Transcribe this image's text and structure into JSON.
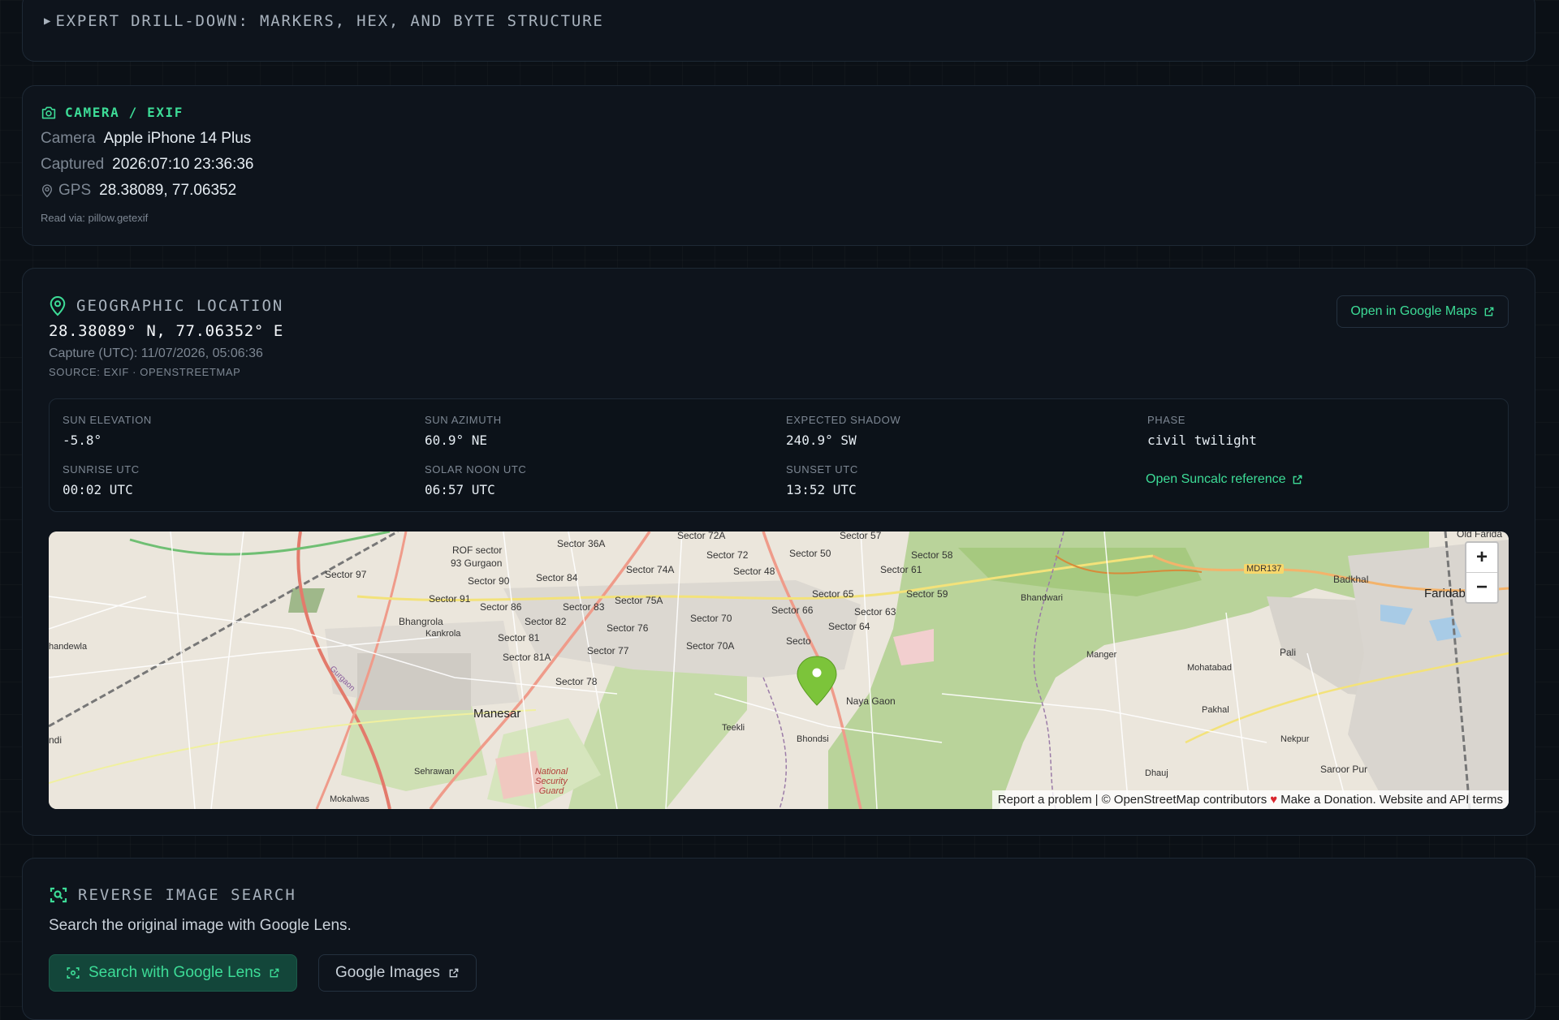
{
  "drilldown": {
    "title": "EXPERT DRILL-DOWN: MARKERS, HEX, AND BYTE STRUCTURE"
  },
  "exif": {
    "title": "CAMERA / EXIF",
    "camera_label": "Camera",
    "camera_value": "Apple iPhone 14 Plus",
    "captured_label": "Captured",
    "captured_value": "2026:07:10 23:36:36",
    "gps_label": "GPS",
    "gps_value": "28.38089, 77.06352",
    "read_via": "Read via: pillow.getexif"
  },
  "geo": {
    "title": "GEOGRAPHIC LOCATION",
    "coords": "28.38089° N, 77.06352° E",
    "capture_utc": "Capture (UTC): 11/07/2026, 05:06:36",
    "source": "SOURCE: EXIF · OPENSTREETMAP",
    "open_maps_label": "Open in Google Maps",
    "sun": {
      "elevation_label": "SUN ELEVATION",
      "elevation_value": "-5.8°",
      "azimuth_label": "SUN AZIMUTH",
      "azimuth_value": "60.9° NE",
      "shadow_label": "EXPECTED SHADOW",
      "shadow_value": "240.9° SW",
      "phase_label": "PHASE",
      "phase_value": "civil twilight",
      "sunrise_label": "SUNRISE UTC",
      "sunrise_value": "00:02 UTC",
      "noon_label": "SOLAR NOON UTC",
      "noon_value": "06:57 UTC",
      "sunset_label": "SUNSET UTC",
      "sunset_value": "13:52 UTC",
      "suncalc_label": "Open Suncalc reference"
    },
    "map": {
      "zoom_in": "+",
      "zoom_out": "−",
      "attribution": {
        "report": "Report a problem",
        "sep": "|",
        "osm": "© OpenStreetMap contributors",
        "heart": "♥",
        "donate": "Make a Donation.",
        "terms": "Website and API terms"
      },
      "labels": {
        "sector36a": "Sector 36A",
        "sector72a": "Sector 72A",
        "sector57": "Sector 57",
        "oldfarida": "Old Farida",
        "rof": "ROF sector",
        "gurgaon93": "93 Gurgaon",
        "sector97": "Sector 97",
        "sector90": "Sector 90",
        "sector84": "Sector 84",
        "sector74a": "Sector 74A",
        "sector72": "Sector 72",
        "sector48": "Sector 48",
        "sector50": "Sector 50",
        "sector58": "Sector 58",
        "sector61": "Sector 61",
        "mdr137": "MDR137",
        "badkhal": "Badkhal",
        "faridab": "Faridab",
        "sector91": "Sector 91",
        "sector86": "Sector 86",
        "sector83": "Sector 83",
        "sector75a": "Sector 75A",
        "sector65": "Sector 65",
        "sector59": "Sector 59",
        "bhandwari": "Bhandwari",
        "sector66": "Sector 66",
        "sector63": "Sector 63",
        "bhangrola": "Bhangrola",
        "sector82": "Sector 82",
        "sector70": "Sector 70",
        "sector64": "Sector 64",
        "kankrola": "Kankrola",
        "sector81": "Sector 81",
        "sector76": "Sector 76",
        "handewla": "handewla",
        "sector70a": "Sector 70A",
        "secto": "Secto",
        "sector77": "Sector 77",
        "sector81a": "Sector 81A",
        "manger": "Manger",
        "pali": "Pali",
        "mohatabad": "Mohatabad",
        "sector78": "Sector 78",
        "gurgaonriver": "Gurgaon",
        "nayagaon": "Naya Gaon",
        "manesar": "Manesar",
        "pakhal": "Pakhal",
        "teekli": "Teekli",
        "ndi": "ndi",
        "bhondsi": "Bhondsi",
        "nekpur": "Nekpur",
        "sehrawan": "Sehrawan",
        "nsg": "National Security Guard",
        "dhauj": "Dhauj",
        "saroorpur": "Saroor Pur",
        "mokalwas": "Mokalwas"
      }
    }
  },
  "reverse": {
    "title": "REVERSE IMAGE SEARCH",
    "description": "Search the original image with Google Lens.",
    "lens_button": "Search with Google Lens",
    "images_button": "Google Images"
  },
  "colors": {
    "accent": "#3ddc97",
    "background": "#0b1016",
    "card": "#0e141c",
    "border": "#1e2935",
    "muted": "#7d8793",
    "map_pin": "#7cc43a"
  }
}
